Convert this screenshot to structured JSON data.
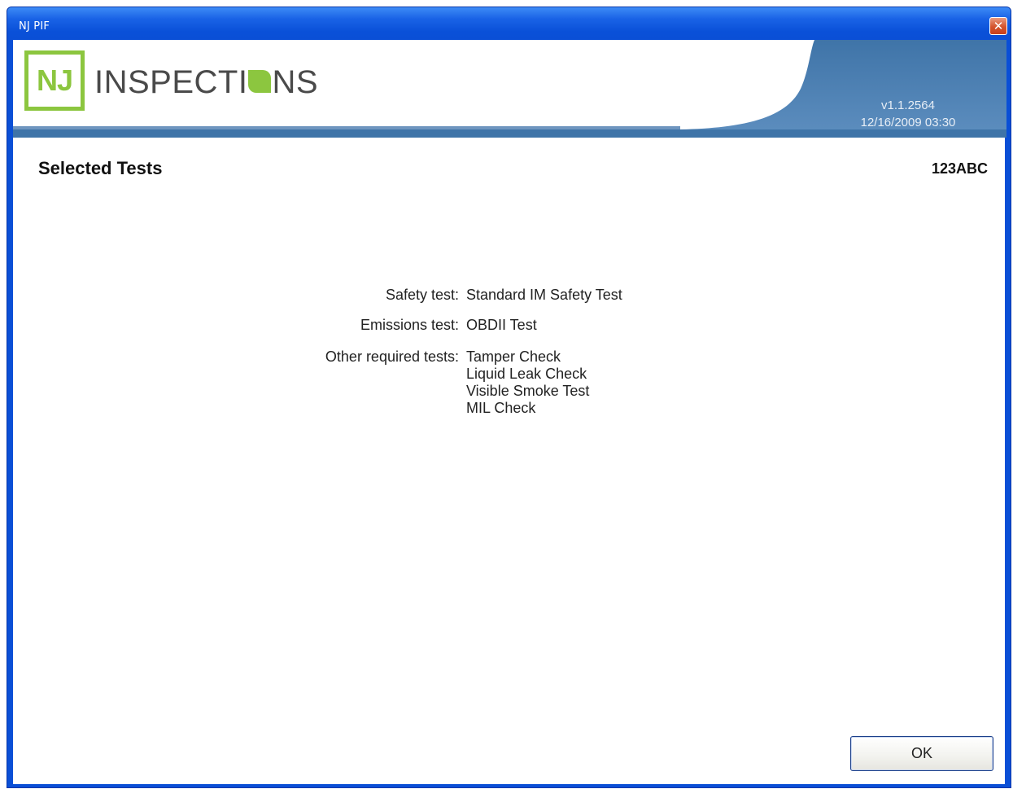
{
  "window": {
    "title": "NJ PIF",
    "close_icon": "close-icon"
  },
  "header": {
    "logo_mark": "NJ",
    "logo_word_part1": "INSPECTI",
    "logo_word_part2": "NS",
    "version": "v1.1.2564",
    "datetime": "12/16/2009 03:30",
    "colors": {
      "banner_blue": "#4d7fb0",
      "logo_green": "#8cc63f"
    }
  },
  "main": {
    "title": "Selected Tests",
    "plate": "123ABC",
    "safety_label": "Safety test:",
    "safety_value": "Standard IM Safety Test",
    "emissions_label": "Emissions test:",
    "emissions_value": "OBDII Test",
    "other_label": "Other required tests:",
    "other_tests": [
      "Tamper Check",
      "Liquid Leak Check",
      "Visible Smoke Test",
      "MIL Check"
    ]
  },
  "footer": {
    "ok_label": "OK"
  }
}
